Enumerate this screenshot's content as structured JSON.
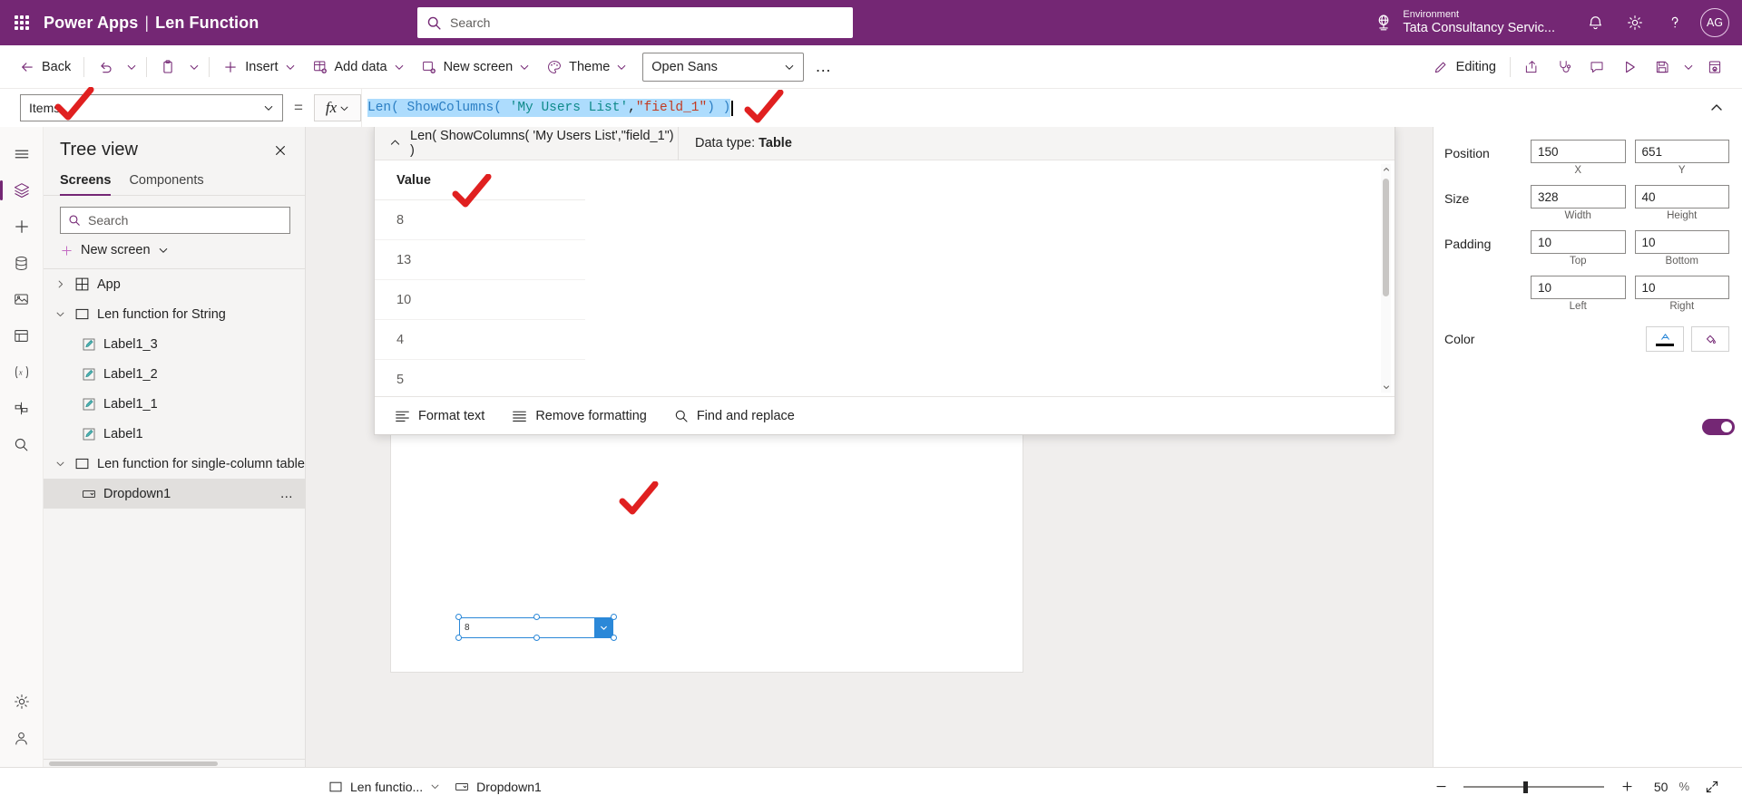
{
  "header": {
    "brand": "Power Apps",
    "separator": "|",
    "app_name": "Len Function",
    "search_placeholder": "Search",
    "environment_label": "Environment",
    "environment_name": "Tata Consultancy Servic...",
    "avatar_initials": "AG",
    "accent_color": "#742774"
  },
  "toolbar": {
    "back": "Back",
    "insert": "Insert",
    "add_data": "Add data",
    "new_screen": "New screen",
    "theme": "Theme",
    "font": "Open Sans",
    "more": "…",
    "editing": "Editing"
  },
  "formula": {
    "property": "Items",
    "equals": "=",
    "fx": "fx",
    "tokens": [
      {
        "t": "Len(",
        "c": "k"
      },
      {
        "t": " ",
        "c": "p"
      },
      {
        "t": "ShowColumns(",
        "c": "k"
      },
      {
        "t": " ",
        "c": "p"
      },
      {
        "t": "'My Users List'",
        "c": "s"
      },
      {
        "t": ",",
        "c": "p"
      },
      {
        "t": "\"field_1\"",
        "c": "str"
      },
      {
        "t": ")",
        "c": "k"
      },
      {
        "t": " ",
        "c": "p"
      },
      {
        "t": ")",
        "c": "k"
      }
    ],
    "plain": "Len( ShowColumns( 'My Users List',\"field_1\") )"
  },
  "intellisense": {
    "expression": "Len( ShowColumns( 'My Users List',\"field_1\") )",
    "datatype_label": "Data type:",
    "datatype_value": "Table",
    "column_header": "Value",
    "values": [
      "8",
      "13",
      "10",
      "4",
      "5"
    ],
    "footer": {
      "format_text": "Format text",
      "remove_formatting": "Remove formatting",
      "find_and_replace": "Find and replace"
    }
  },
  "treeview": {
    "title": "Tree view",
    "tabs": [
      {
        "label": "Screens",
        "active": true
      },
      {
        "label": "Components",
        "active": false
      }
    ],
    "search_placeholder": "Search",
    "new_screen": "New screen",
    "nodes": [
      {
        "label": "App",
        "level": 1,
        "icon": "app-icon",
        "chevron": "collapsed",
        "selected": false
      },
      {
        "label": "Len function for String",
        "level": 1,
        "icon": "screen-icon",
        "chevron": "expanded",
        "selected": false
      },
      {
        "label": "Label1_3",
        "level": 2,
        "icon": "label-icon",
        "chevron": "none",
        "selected": false
      },
      {
        "label": "Label1_2",
        "level": 2,
        "icon": "label-icon",
        "chevron": "none",
        "selected": false
      },
      {
        "label": "Label1_1",
        "level": 2,
        "icon": "label-icon",
        "chevron": "none",
        "selected": false
      },
      {
        "label": "Label1",
        "level": 2,
        "icon": "label-icon",
        "chevron": "none",
        "selected": false
      },
      {
        "label": "Len function for single-column table",
        "level": 1,
        "icon": "screen-icon",
        "chevron": "expanded",
        "selected": false
      },
      {
        "label": "Dropdown1",
        "level": 2,
        "icon": "dropdown-icon",
        "chevron": "none",
        "selected": true,
        "overflow": "…"
      }
    ]
  },
  "canvas": {
    "dropdown_value": "8"
  },
  "properties": {
    "position": {
      "label": "Position",
      "x": "150",
      "y": "651",
      "x_sub": "X",
      "y_sub": "Y"
    },
    "size": {
      "label": "Size",
      "width": "328",
      "height": "40",
      "width_sub": "Width",
      "height_sub": "Height"
    },
    "padding": {
      "label": "Padding",
      "top": "10",
      "bottom": "10",
      "left": "10",
      "right": "10",
      "top_sub": "Top",
      "bottom_sub": "Bottom",
      "left_sub": "Left",
      "right_sub": "Right"
    },
    "color": {
      "label": "Color"
    }
  },
  "statusbar": {
    "screen_name": "Len functio...",
    "control_name": "Dropdown1",
    "zoom_value": "50",
    "zoom_unit": "%"
  }
}
